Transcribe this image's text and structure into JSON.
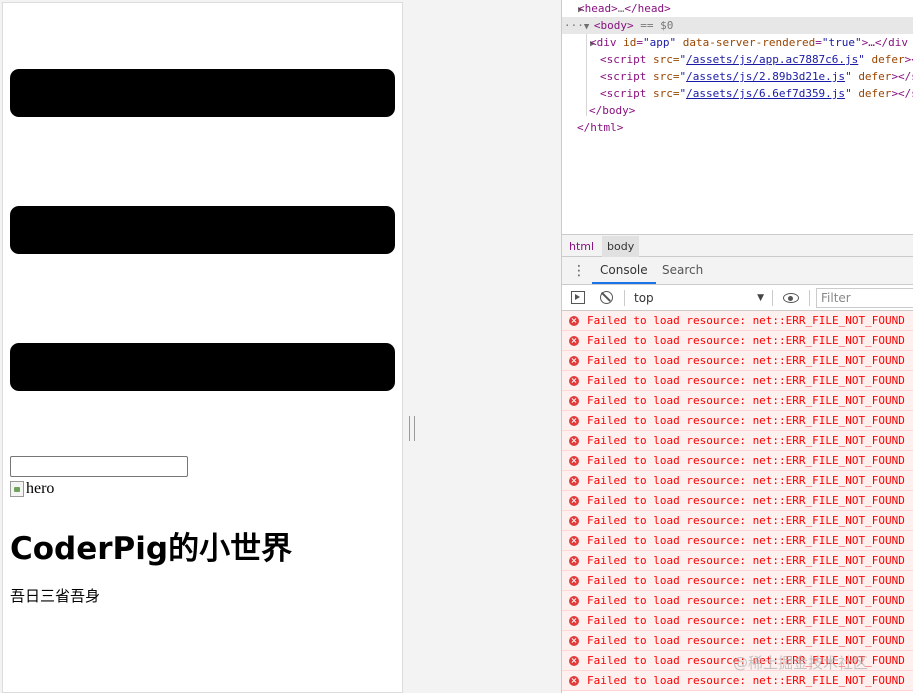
{
  "page": {
    "image_alt": "hero",
    "title": "CoderPig的小世界",
    "description": "吾日三省吾身"
  },
  "elements_tree": {
    "head_line": {
      "open": "<head>",
      "ellipsis": "…",
      "close": "</head>"
    },
    "body_line": {
      "dots": "···",
      "open": "<body>",
      "eq": " == $0"
    },
    "div_line": {
      "open": "<div",
      "attr1_name": "id",
      "attr1_val": "\"app\"",
      "attr2_name": "data-server-rendered",
      "attr2_val": "\"true\"",
      "rest": ">…</div"
    },
    "scripts": [
      {
        "src": "/assets/js/app.ac7887c6.js",
        "defer": "defer"
      },
      {
        "src": "/assets/js/2.89b3d21e.js",
        "defer": "defer"
      },
      {
        "src": "/assets/js/6.6ef7d359.js",
        "defer": "defer"
      }
    ],
    "script_open": "<script",
    "script_attr": "src=",
    "script_close": "></s",
    "body_close": "</body>",
    "html_close": "</html>"
  },
  "breadcrumbs": [
    "html",
    "body"
  ],
  "drawer_tabs": {
    "console": "Console",
    "search": "Search"
  },
  "console_toolbar": {
    "context": "top",
    "filter_placeholder": "Filter"
  },
  "console_messages": [
    "Failed to load resource: net::ERR_FILE_NOT_FOUND",
    "Failed to load resource: net::ERR_FILE_NOT_FOUND",
    "Failed to load resource: net::ERR_FILE_NOT_FOUND",
    "Failed to load resource: net::ERR_FILE_NOT_FOUND",
    "Failed to load resource: net::ERR_FILE_NOT_FOUND",
    "Failed to load resource: net::ERR_FILE_NOT_FOUND",
    "Failed to load resource: net::ERR_FILE_NOT_FOUND",
    "Failed to load resource: net::ERR_FILE_NOT_FOUND",
    "Failed to load resource: net::ERR_FILE_NOT_FOUND",
    "Failed to load resource: net::ERR_FILE_NOT_FOUND",
    "Failed to load resource: net::ERR_FILE_NOT_FOUND",
    "Failed to load resource: net::ERR_FILE_NOT_FOUND",
    "Failed to load resource: net::ERR_FILE_NOT_FOUND",
    "Failed to load resource: net::ERR_FILE_NOT_FOUND",
    "Failed to load resource: net::ERR_FILE_NOT_FOUND",
    "Failed to load resource: net::ERR_FILE_NOT_FOUND",
    "Failed to load resource: net::ERR_FILE_NOT_FOUND",
    "Failed to load resource: net::ERR_FILE_NOT_FOUND",
    "Failed to load resource: net::ERR_FILE_NOT_FOUND"
  ],
  "watermark": "@稀土掘金技术社区",
  "colors": {
    "error_text": "#ff0000",
    "error_background": "#fff0f0",
    "tag": "#881280",
    "attr_name": "#994500",
    "attr_value": "#1a1aa6",
    "tab_active_underline": "#1a73e8"
  }
}
